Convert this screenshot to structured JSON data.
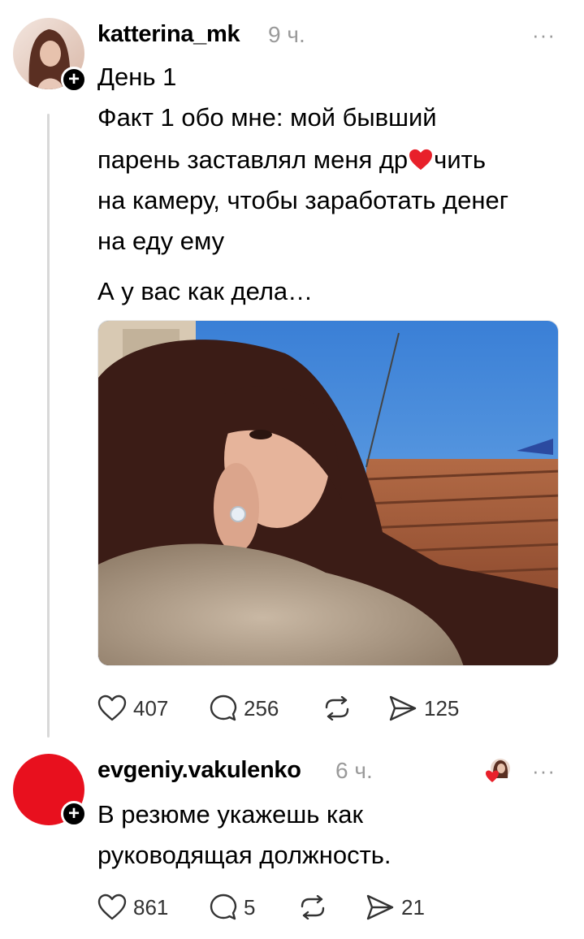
{
  "post": {
    "username": "katterina_mk",
    "time": "9 ч.",
    "more": "···",
    "lines": [
      "День 1",
      "Факт 1 обо мне: мой бывший",
      "парень заставлял меня др",
      "чить",
      "на камеру, чтобы заработать денег",
      "на еду ему",
      "А у вас как дела…"
    ],
    "likes": "407",
    "comments": "256",
    "shares": "125"
  },
  "reply": {
    "username": "evgeniy.vakulenko",
    "time": "6 ч.",
    "more": "···",
    "lines": [
      "В резюме укажешь как",
      "руководящая должность."
    ],
    "likes": "861",
    "comments": "5",
    "shares": "21"
  },
  "colors": {
    "reply_avatar": "#e8101e",
    "heart_emoji": "#e8202a",
    "muted": "#9a9a9a"
  }
}
